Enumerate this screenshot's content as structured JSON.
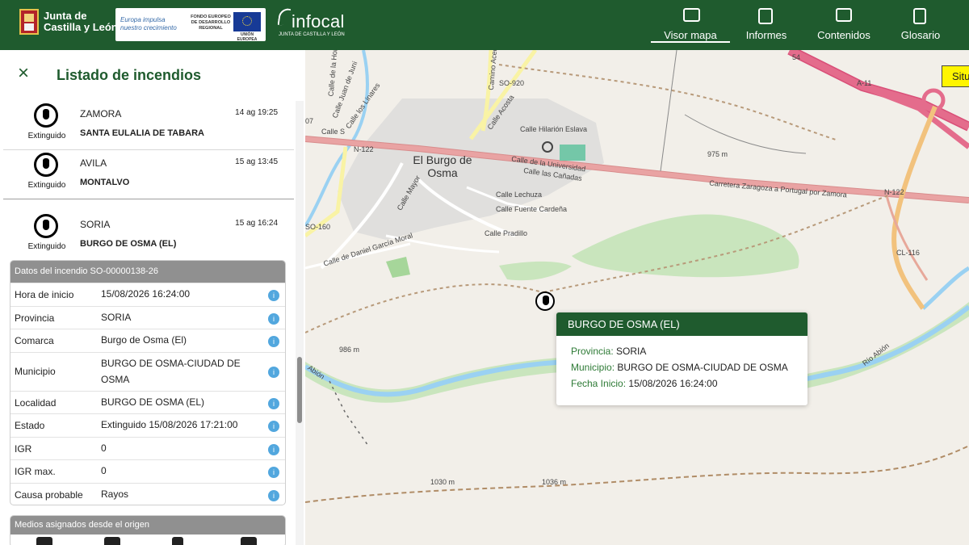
{
  "header": {
    "jcyl_line1": "Junta de",
    "jcyl_line2": "Castilla y León",
    "eu_left_line1": "Europa impulsa",
    "eu_left_line2": "nuestro crecimiento",
    "eu_mid": "FONDO EUROPEO DE DESARROLLO REGIONAL",
    "eu_flag_text": "UNIÓN EUROPEA",
    "infocal_word": "infocal",
    "infocal_sub": "JUNTA DE CASTILLA Y LEÓN",
    "nav": [
      {
        "label": "Visor mapa",
        "icon": "map-icon"
      },
      {
        "label": "Informes",
        "icon": "report-icon"
      },
      {
        "label": "Contenidos",
        "icon": "content-icon"
      },
      {
        "label": "Glosario",
        "icon": "glossary-icon"
      }
    ]
  },
  "sidebar": {
    "title": "Listado de incendios",
    "fires": [
      {
        "province": "ZAMORA",
        "municipality": "SANTA EULALIA DE TABARA",
        "time": "14 ag 19:25",
        "status": "Extinguido"
      },
      {
        "province": "AVILA",
        "municipality": "MONTALVO",
        "time": "15 ag 13:45",
        "status": "Extinguido"
      },
      {
        "province": "SORIA",
        "municipality": "BURGO DE OSMA (EL)",
        "time": "15 ag 16:24",
        "status": "Extinguido"
      }
    ],
    "detail_title": "Datos del incendio SO-00000138-26",
    "details": [
      {
        "key": "Hora de inicio",
        "value": "15/08/2026 16:24:00"
      },
      {
        "key": "Provincia",
        "value": "SORIA"
      },
      {
        "key": "Comarca",
        "value": "Burgo de Osma (El)"
      },
      {
        "key": "Municipio",
        "value": "BURGO DE OSMA-CIUDAD DE OSMA"
      },
      {
        "key": "Localidad",
        "value": "BURGO DE OSMA (EL)"
      },
      {
        "key": "Estado",
        "value": "Extinguido 15/08/2026 17:21:00"
      },
      {
        "key": "IGR",
        "value": "0"
      },
      {
        "key": "IGR max.",
        "value": "0"
      },
      {
        "key": "Causa probable",
        "value": "Rayos"
      }
    ],
    "medios_title": "Medios asignados desde el origen"
  },
  "map": {
    "situ_label": "Situ",
    "town": "El Burgo de Osma",
    "labels": [
      {
        "text": "N-122"
      },
      {
        "text": "SO-920"
      },
      {
        "text": "Calle Acosta"
      },
      {
        "text": "Calle Hilarión Eslava"
      },
      {
        "text": "Calle de la Universidad"
      },
      {
        "text": "Calle las Cañadas"
      },
      {
        "text": "Carretera Zaragoza a Portugal por Zamora"
      },
      {
        "text": "N-122"
      },
      {
        "text": "975 m"
      },
      {
        "text": "A-11"
      },
      {
        "text": "CL-116"
      },
      {
        "text": "SO-160"
      },
      {
        "text": "Calle Lechuza"
      },
      {
        "text": "Calle Fuente Cardeña"
      },
      {
        "text": "Calle Pradillo"
      },
      {
        "text": "Calle de Daniel García Moral"
      },
      {
        "text": "986 m"
      },
      {
        "text": "1030 m"
      },
      {
        "text": "1036 m"
      },
      {
        "text": "Río Abión"
      },
      {
        "text": "Abión"
      },
      {
        "text": "Camino Acequia"
      },
      {
        "text": "Calle Mayor"
      },
      {
        "text": "Calle de la Horca"
      },
      {
        "text": "Calle Juan de Juni"
      },
      {
        "text": "Calle los Linares"
      },
      {
        "text": "Calle S"
      },
      {
        "text": "07"
      },
      {
        "text": "54"
      }
    ],
    "popup": {
      "title": "BURGO DE OSMA (EL)",
      "rows": [
        {
          "key": "Provincia:",
          "value": "SORIA"
        },
        {
          "key": "Municipio:",
          "value": "BURGO DE OSMA-CIUDAD DE OSMA"
        },
        {
          "key": "Fecha Inicio:",
          "value": "15/08/2026 16:24:00"
        }
      ]
    }
  },
  "colors": {
    "brand": "#1f5b2e",
    "info": "#52a7de",
    "road_major": "#e9a3a3",
    "road_highway": "#e46c8c",
    "river": "#9ad1f2",
    "park": "#c9e5bd"
  }
}
